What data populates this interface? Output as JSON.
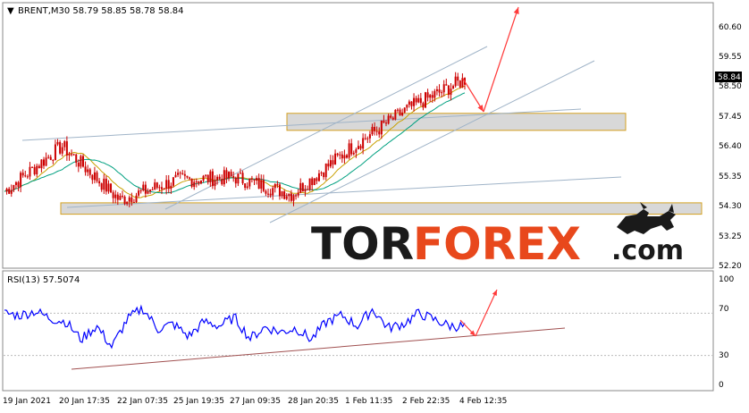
{
  "header": {
    "symbol_line": "BRENT,M30  58.79 58.85 58.78 58.84",
    "rsi_label": "RSI(13) 57.5074"
  },
  "price_axis": {
    "ticks": [
      "60.60",
      "59.55",
      "58.50",
      "57.45",
      "56.40",
      "55.35",
      "54.30",
      "53.25",
      "52.20"
    ],
    "current_price": "58.84"
  },
  "rsi_axis": {
    "ticks": [
      "100",
      "70",
      "30",
      "0"
    ]
  },
  "time_axis": {
    "labels": [
      "19 Jan 2021",
      "20 Jan 17:35",
      "22 Jan 07:35",
      "25 Jan 19:35",
      "27 Jan 09:35",
      "28 Jan 20:35",
      "1 Feb 11:35",
      "2 Feb 22:35",
      "4 Feb 12:35"
    ]
  },
  "watermark": {
    "part1": "TOR",
    "part2": "FOREX",
    "part3": ".com"
  },
  "colors": {
    "candle": "#cc0000",
    "ma_fast": "#c8a000",
    "ma_slow": "#00a080",
    "rsi": "#0000ff",
    "channel": "#a0b4c8",
    "zone": "#d4a020",
    "arrow": "#ff3b3b",
    "trend": "#a05050",
    "watermark_dark": "#1a1a1a",
    "watermark_accent": "#e8481c"
  },
  "chart_data": {
    "type": "line",
    "title": "BRENT,M30",
    "ylim": [
      51.9,
      61.3
    ],
    "series": [
      {
        "name": "BRENT",
        "x": [
          "19 Jan 2021",
          "20 Jan 17:35",
          "22 Jan 07:35",
          "25 Jan 19:35",
          "27 Jan 09:35",
          "28 Jan 20:35",
          "1 Feb 11:35",
          "2 Feb 22:35",
          "4 Feb 12:35"
        ],
        "values": [
          54.9,
          56.5,
          54.6,
          55.3,
          55.4,
          54.8,
          56.4,
          57.8,
          58.84
        ]
      }
    ],
    "zones": [
      {
        "from": 57.05,
        "to": 57.65
      },
      {
        "from": 54.1,
        "to": 54.5
      }
    ],
    "rsi": {
      "name": "RSI(13) 57.5074",
      "ylim": [
        0,
        100
      ],
      "levels": [
        70,
        30
      ],
      "values": [
        70,
        68,
        72,
        65,
        62,
        45,
        58,
        38,
        64,
        75,
        55,
        60,
        48,
        62,
        58,
        66,
        46,
        57,
        52,
        56,
        45,
        62,
        68,
        58,
        74,
        56,
        60,
        70,
        64,
        58,
        57.5
      ]
    }
  }
}
